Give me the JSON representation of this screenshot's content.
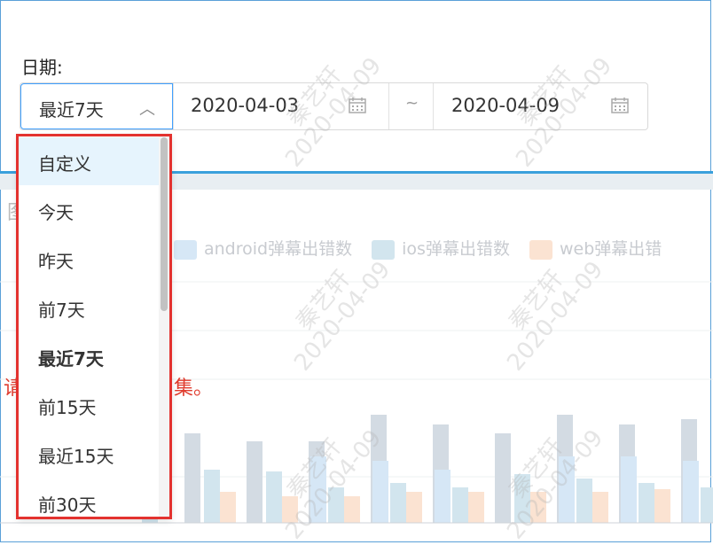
{
  "filter": {
    "label": "日期:",
    "preset_value": "最近7天",
    "start_date": "2020-04-03",
    "separator": "~",
    "end_date": "2020-04-09"
  },
  "chart_panel": {
    "title_fragment": "图",
    "legend": [
      {
        "name": "android弹幕出错数",
        "color": "#d6e7f6"
      },
      {
        "name": "ios弹幕出错数",
        "color": "#d2e5ee"
      },
      {
        "name": "web弹幕出错",
        "color": "#fbe3d2"
      }
    ],
    "warning_start": "请",
    "warning_end": "集。"
  },
  "watermark": {
    "name": "秦艺轩",
    "date": "2020-04-09"
  },
  "dropdown": {
    "items": [
      {
        "label": "自定义",
        "active": true
      },
      {
        "label": "今天"
      },
      {
        "label": "昨天"
      },
      {
        "label": "前7天"
      },
      {
        "label": "最近7天",
        "selected": true
      },
      {
        "label": "前15天"
      },
      {
        "label": "最近15天"
      },
      {
        "label": "前30天"
      }
    ]
  },
  "colors": {
    "accent": "#40a0ff",
    "highlight_border": "#e3322f",
    "warning": "#e03c2e"
  }
}
